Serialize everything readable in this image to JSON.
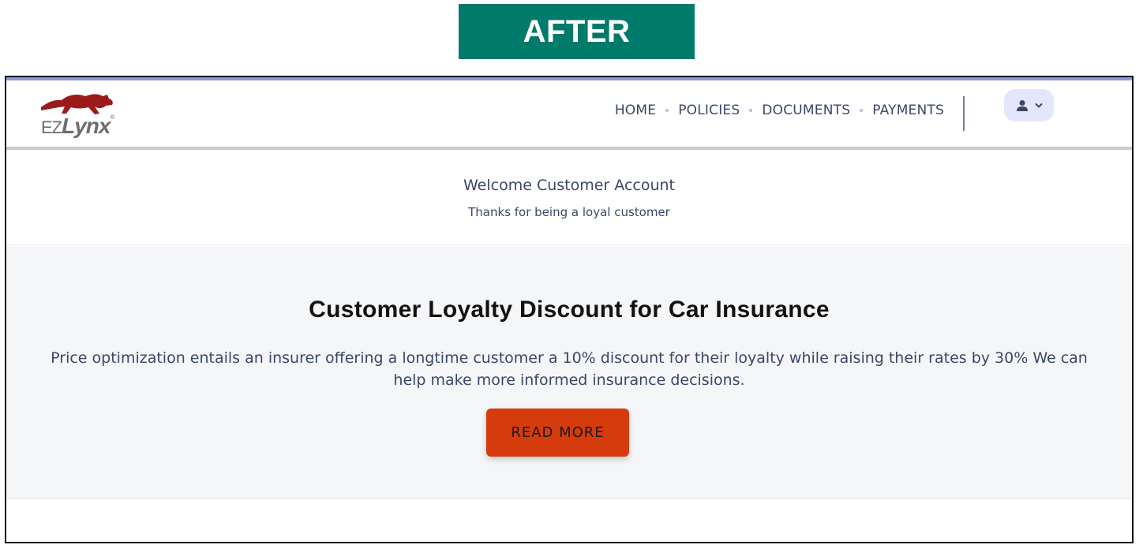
{
  "banner": {
    "label": "AFTER"
  },
  "brand": {
    "logo_ez": "EZ",
    "logo_lynx": "Lynx",
    "logo_reg": "®",
    "logo_color": "#9b1b1b"
  },
  "nav": {
    "items": [
      {
        "label": "HOME"
      },
      {
        "label": "POLICIES"
      },
      {
        "label": "DOCUMENTS"
      },
      {
        "label": "PAYMENTS"
      }
    ]
  },
  "user_menu": {
    "icon": "user-icon",
    "chevron": "chevron-down-icon"
  },
  "welcome": {
    "title": "Welcome Customer Account",
    "subtitle": "Thanks for being a loyal customer"
  },
  "promo": {
    "title": "Customer Loyalty Discount for Car Insurance",
    "text": "Price optimization entails an insurer offering a longtime customer a 10% discount for their loyalty while raising their rates by 30% We can help make more informed insurance decisions.",
    "button_label": "READ MORE",
    "button_color": "#d53b0c"
  },
  "colors": {
    "banner_bg": "#007a6a",
    "text_primary": "#3a4767",
    "accent_top": "#8e9be0",
    "user_btn_bg": "#e4e7fb"
  }
}
